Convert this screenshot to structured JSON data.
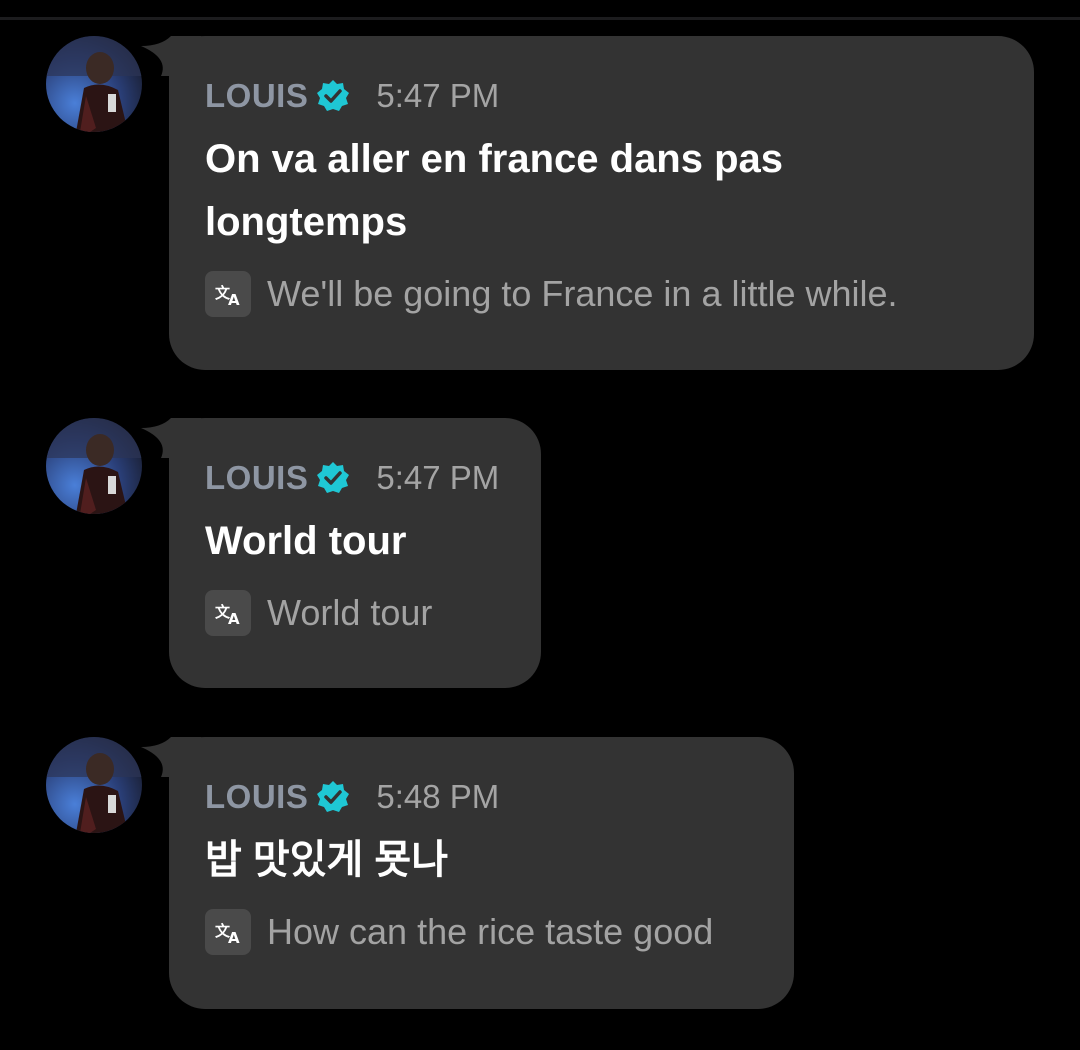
{
  "messages": [
    {
      "sender": "LOUIS",
      "verified": true,
      "time": "5:47 PM",
      "text": "On va aller en france dans pas longtemps",
      "translation": "We'll be going to France in a little while."
    },
    {
      "sender": "LOUIS",
      "verified": true,
      "time": "5:47 PM",
      "text": "World tour",
      "translation": "World tour"
    },
    {
      "sender": "LOUIS",
      "verified": true,
      "time": "5:48 PM",
      "text": "밥 맛있게 묫나",
      "translation": "How can the rice taste good"
    }
  ],
  "icons": {
    "verified": "verified-badge-icon",
    "translate": "translate-icon"
  },
  "colors": {
    "background": "#000000",
    "bubble": "#333333",
    "verified_badge": "#1fc7d4",
    "sender_name": "#8e96a3",
    "translation_text": "#a3a3a3"
  }
}
